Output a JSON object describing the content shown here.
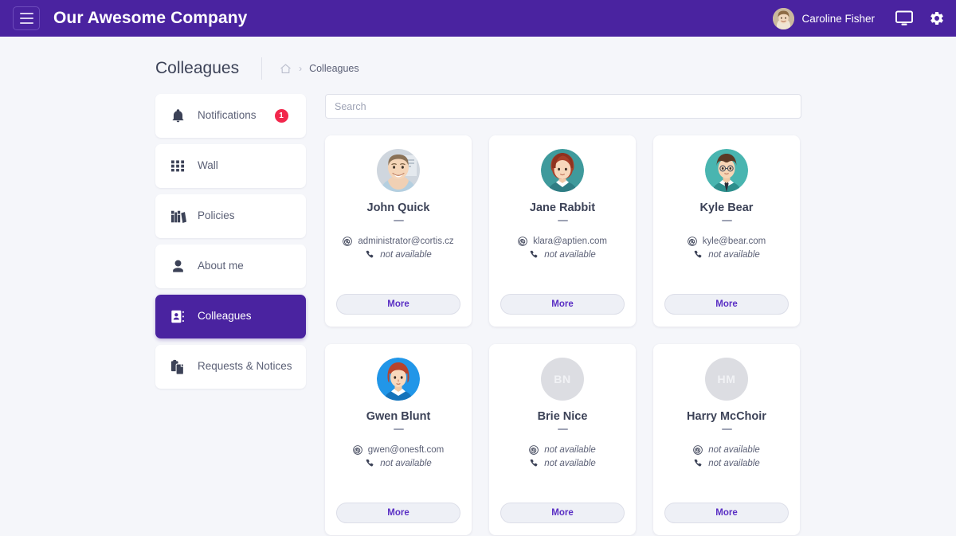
{
  "topbar": {
    "menu_icon": "hamburger-icon",
    "brand": "Our Awesome Company",
    "user": {
      "name": "Caroline Fisher",
      "avatar_type": "photo"
    },
    "icons": [
      {
        "name": "monitor-icon"
      },
      {
        "name": "gear-icon"
      }
    ]
  },
  "page": {
    "title": "Colleagues",
    "breadcrumb": {
      "home_icon": "home-icon",
      "separator": "›",
      "current": "Colleagues"
    }
  },
  "sidebar": {
    "items": [
      {
        "label": "Notifications",
        "icon": "bell-icon",
        "badge": "1",
        "active": false
      },
      {
        "label": "Wall",
        "icon": "grid-dots-icon",
        "badge": null,
        "active": false
      },
      {
        "label": "Policies",
        "icon": "books-icon",
        "badge": null,
        "active": false
      },
      {
        "label": "About me",
        "icon": "person-icon",
        "badge": null,
        "active": false
      },
      {
        "label": "Colleagues",
        "icon": "contact-card-icon",
        "badge": null,
        "active": true
      },
      {
        "label": "Requests & Notices",
        "icon": "clipboard-icon",
        "badge": null,
        "active": false
      }
    ]
  },
  "search": {
    "placeholder": "Search",
    "value": ""
  },
  "colleagues": {
    "more_label": "More",
    "email_icon": "at-sign-icon",
    "phone_icon": "phone-icon",
    "cards": [
      {
        "name": "John Quick",
        "avatar": {
          "type": "photo",
          "style": "man-photo"
        },
        "email": "administrator@cortis.cz",
        "email_available": true,
        "phone": "not available",
        "phone_available": false
      },
      {
        "name": "Jane Rabbit",
        "avatar": {
          "type": "illustration",
          "style": "woman-red-hair",
          "bg": "#3f9a9c"
        },
        "email": "klara@aptien.com",
        "email_available": true,
        "phone": "not available",
        "phone_available": false
      },
      {
        "name": "Kyle Bear",
        "avatar": {
          "type": "illustration",
          "style": "man-glasses-tie",
          "bg": "#49b5b0"
        },
        "email": "kyle@bear.com",
        "email_available": true,
        "phone": "not available",
        "phone_available": false
      },
      {
        "name": "Gwen Blunt",
        "avatar": {
          "type": "illustration",
          "style": "woman-bob-hair",
          "bg": "#2196e8"
        },
        "email": "gwen@onesft.com",
        "email_available": true,
        "phone": "not available",
        "phone_available": false
      },
      {
        "name": "Brie Nice",
        "avatar": {
          "type": "initials",
          "initials": "BN",
          "bg": "#dcdde2"
        },
        "email": "not available",
        "email_available": false,
        "phone": "not available",
        "phone_available": false
      },
      {
        "name": "Harry McChoir",
        "avatar": {
          "type": "initials",
          "initials": "HM",
          "bg": "#dcdde2"
        },
        "email": "not available",
        "email_available": false,
        "phone": "not available",
        "phone_available": false
      }
    ]
  },
  "colors": {
    "brand_purple": "#4a23a0",
    "accent_purple": "#5a2fc4",
    "badge_red": "#f2274c",
    "page_bg": "#f5f6fa"
  }
}
